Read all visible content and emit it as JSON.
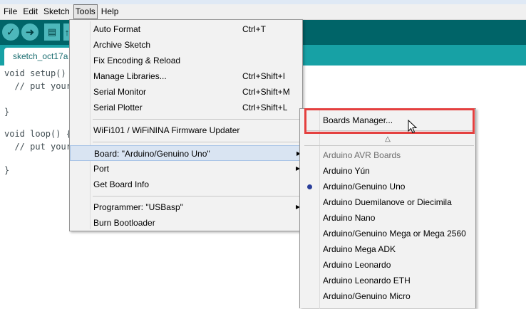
{
  "menubar": {
    "items": [
      {
        "label": "File"
      },
      {
        "label": "Edit"
      },
      {
        "label": "Sketch"
      },
      {
        "label": "Tools",
        "active": true
      },
      {
        "label": "Help"
      }
    ]
  },
  "toolbar": {
    "buttons": [
      "verify-icon",
      "upload-icon",
      "new-icon",
      "open-icon"
    ]
  },
  "tab": {
    "label": "sketch_oct17a"
  },
  "editor": {
    "lines": [
      "void setup() {",
      "  // put your setup code here, to run once:",
      "",
      "}",
      "",
      "void loop() {",
      "  // put your main code here, to run repeatedly:",
      "",
      "}"
    ]
  },
  "tools_menu": {
    "items": [
      {
        "label": "Auto Format",
        "shortcut": "Ctrl+T"
      },
      {
        "label": "Archive Sketch",
        "shortcut": ""
      },
      {
        "label": "Fix Encoding & Reload",
        "shortcut": ""
      },
      {
        "label": "Manage Libraries...",
        "shortcut": "Ctrl+Shift+I"
      },
      {
        "label": "Serial Monitor",
        "shortcut": "Ctrl+Shift+M"
      },
      {
        "label": "Serial Plotter",
        "shortcut": "Ctrl+Shift+L"
      },
      {
        "label": "WiFi101 / WiFiNINA Firmware Updater",
        "shortcut": ""
      },
      {
        "label": "Board: \"Arduino/Genuino Uno\"",
        "shortcut": "",
        "submenu": true
      },
      {
        "label": "Port",
        "shortcut": "",
        "submenu": true
      },
      {
        "label": "Get Board Info",
        "shortcut": ""
      },
      {
        "label": "Programmer: \"USBasp\"",
        "shortcut": "",
        "submenu": true
      },
      {
        "label": "Burn Bootloader",
        "shortcut": ""
      }
    ]
  },
  "boards_menu": {
    "manager_label": "Boards Manager...",
    "scroll_up_glyph": "△",
    "section_header": "Arduino AVR Boards",
    "boards": [
      {
        "label": "Arduino Yún"
      },
      {
        "label": "Arduino/Genuino Uno",
        "selected": true
      },
      {
        "label": "Arduino Duemilanove or Diecimila"
      },
      {
        "label": "Arduino Nano"
      },
      {
        "label": "Arduino/Genuino Mega or Mega 2560"
      },
      {
        "label": "Arduino Mega ADK"
      },
      {
        "label": "Arduino Leonardo"
      },
      {
        "label": "Arduino Leonardo ETH"
      },
      {
        "label": "Arduino/Genuino Micro"
      }
    ]
  },
  "colors": {
    "toolbar": "#006468",
    "tab_row": "#17a1a5",
    "highlight_box": "#e4403f"
  }
}
